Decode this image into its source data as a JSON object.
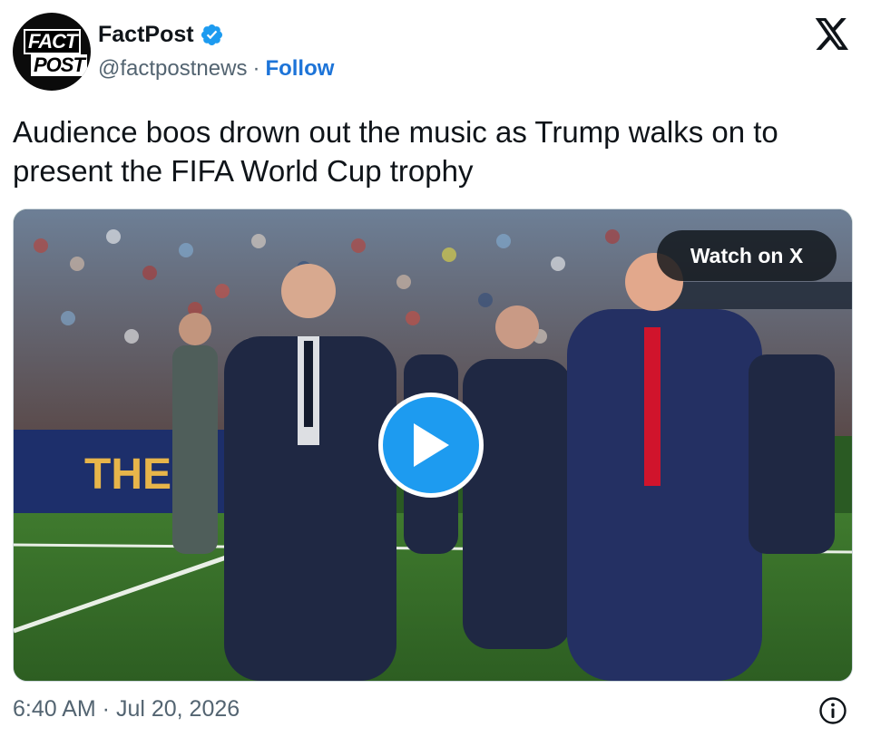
{
  "author": {
    "display_name": "FactPost",
    "handle": "@factpostnews",
    "separator": "·",
    "follow_label": "Follow",
    "avatar_line1": "FACT",
    "avatar_line2": "POST",
    "verified_icon": "verified-badge-icon"
  },
  "tweet": {
    "text": "Audience boos drown out the music as Trump walks on to present the FIFA World Cup trophy",
    "timestamp": "6:40 AM · Jul 20, 2026"
  },
  "media": {
    "watch_label": "Watch on X",
    "play_icon": "play-icon",
    "banner_text": "THE F"
  },
  "icons": {
    "logo": "x-logo-icon",
    "info": "info-icon"
  },
  "colors": {
    "accent": "#1d9bf0",
    "follow": "#1d74d8",
    "text": "#0f1419",
    "muted": "#536471"
  }
}
